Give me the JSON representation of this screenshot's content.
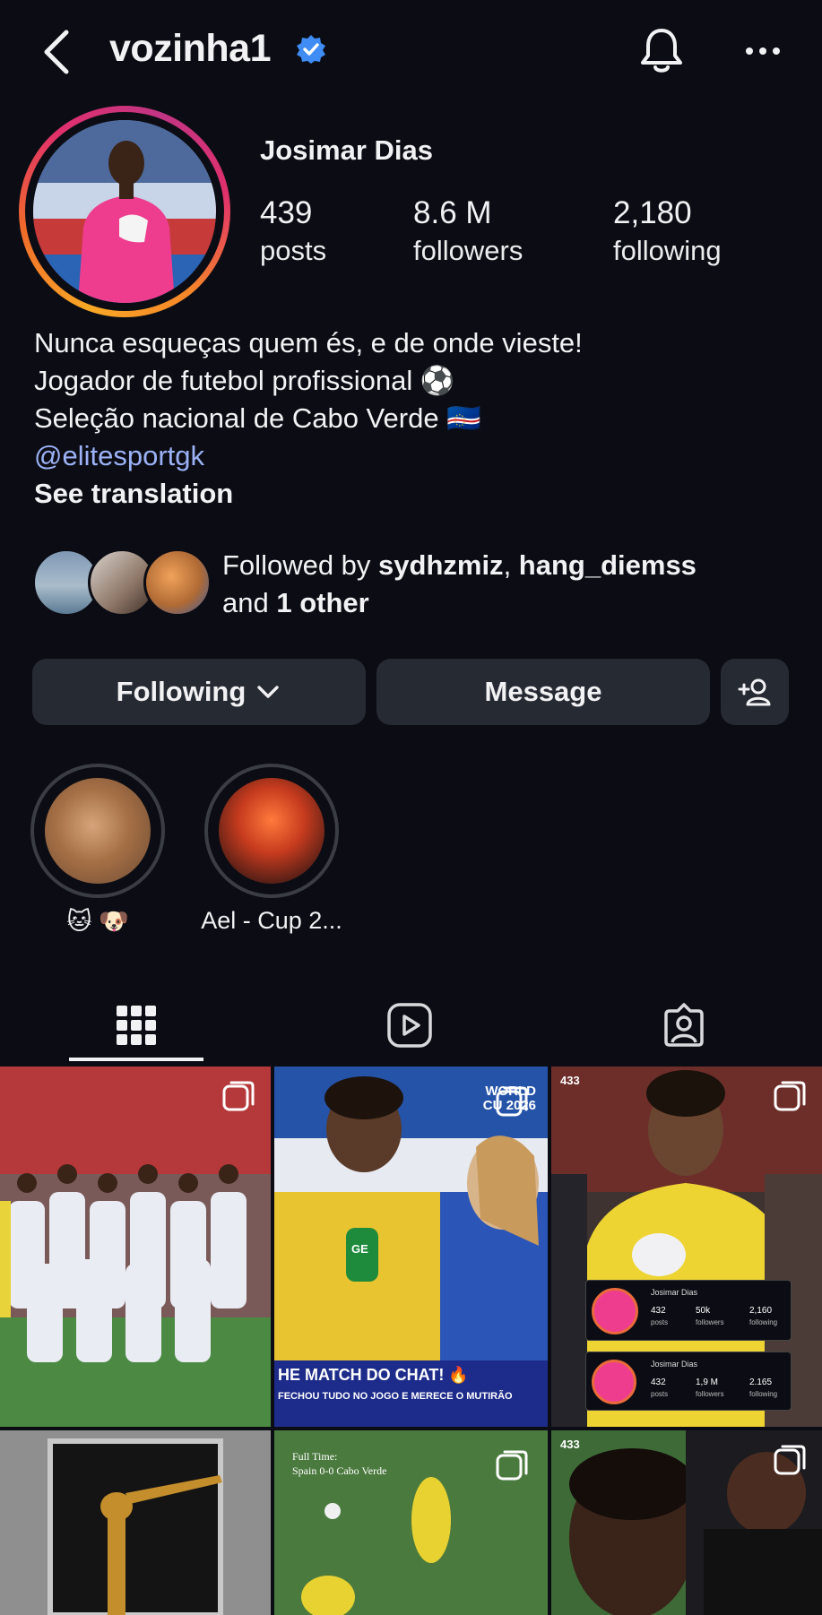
{
  "header": {
    "username": "vozinha1",
    "icons": [
      "back-chevron-icon",
      "verified-badge-icon",
      "notification-bell-icon",
      "more-options-icon"
    ]
  },
  "profile": {
    "display_name": "Josimar Dias",
    "stats": [
      {
        "value": "439",
        "label": "posts"
      },
      {
        "value": "8.6 M",
        "label": "followers"
      },
      {
        "value": "2,180",
        "label": "following"
      }
    ],
    "bio_lines": [
      "Nunca esqueças quem és, e de onde vieste!",
      "Jogador de futebol profissional ⚽",
      "Seleção nacional de Cabo Verde 🇨🇻"
    ],
    "link": "@elitesportgk",
    "see_translation": "See translation"
  },
  "followed_by": {
    "prefix": "Followed by ",
    "user1": "sydhzmiz",
    "sep": ", ",
    "user2": "hang_diemss",
    "and": "and ",
    "others": "1 other"
  },
  "actions": {
    "following_label": "Following",
    "message_label": "Message",
    "add_user_icon": "add-person-icon"
  },
  "highlights": [
    {
      "label": "🐱 🐶"
    },
    {
      "label": "Ael - Cup 2..."
    }
  ],
  "tabs": [
    "grid-icon",
    "reels-icon",
    "tagged-icon"
  ],
  "grid_posts": [
    {
      "caption": ""
    },
    {
      "caption": "HE MATCH DO CHAT! 🔥",
      "subcaption": "FECHOU TUDO NO JOGO E MERECE O MUTIRÃO",
      "badge": "WORLD CU 2026",
      "mic": "GE"
    },
    {
      "caption": "",
      "card1": {
        "name": "Josimar Dias",
        "posts": "432",
        "followers": "50k",
        "following": "2,160"
      },
      "card2": {
        "name": "Josimar Dias",
        "posts": "432",
        "followers": "1,9 M",
        "following": "2.165"
      },
      "card_labels": {
        "posts": "posts",
        "followers": "followers",
        "following": "following"
      },
      "watermark": "433"
    },
    {
      "caption": ""
    },
    {
      "caption": "Full Time:",
      "subcaption": "Spain 0-0 Cabo Verde"
    },
    {
      "caption": "",
      "watermark": "433"
    }
  ]
}
